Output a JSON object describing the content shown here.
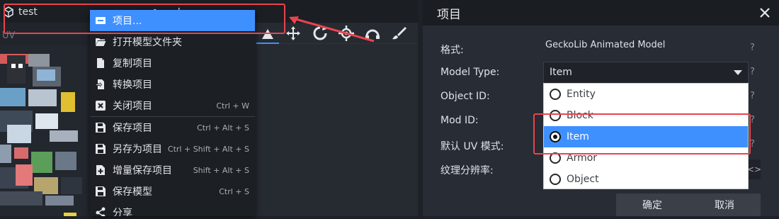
{
  "tab": {
    "title": "test",
    "plus_label": "+"
  },
  "uv": {
    "label": "UV"
  },
  "file_menu": {
    "items": [
      {
        "label": "项目...",
        "shortcut": "",
        "icon": "project-icon"
      },
      {
        "label": "打开模型文件夹",
        "shortcut": "",
        "icon": "folder-open-icon"
      },
      {
        "label": "复制项目",
        "shortcut": "",
        "icon": "copy-icon"
      },
      {
        "label": "转换项目",
        "shortcut": "",
        "icon": "convert-icon"
      },
      {
        "label": "关闭项目",
        "shortcut": "Ctrl + W",
        "icon": "close-box-icon"
      },
      {
        "label": "保存项目",
        "shortcut": "Ctrl + Alt + S",
        "icon": "save-icon"
      },
      {
        "label": "另存为项目",
        "shortcut": "Ctrl + Shift + Alt + S",
        "icon": "save-as-icon"
      },
      {
        "label": "增量保存项目",
        "shortcut": "Shift + Alt + S",
        "icon": "save-increment-icon"
      },
      {
        "label": "保存模型",
        "shortcut": "Ctrl + S",
        "icon": "save-model-icon"
      },
      {
        "label": "分享",
        "shortcut": "",
        "icon": "share-icon"
      }
    ]
  },
  "dialog": {
    "title": "项目",
    "fields": {
      "format_label": "格式:",
      "format_value": "GeckoLib Animated Model",
      "model_type_label": "Model Type:",
      "model_type_value": "Item",
      "object_id_label": "Object ID:",
      "mod_id_label": "Mod ID:",
      "uv_mode_label": "默认 UV 模式:",
      "texture_res_label": "纹理分辨率:"
    },
    "help": "?",
    "model_type_options": [
      "Entity",
      "Block",
      "Item",
      "Armor",
      "Object"
    ],
    "selected_option": "Item",
    "confirm_label": "确定",
    "cancel_label": "取消"
  },
  "colors": {
    "accent": "#3e90ff",
    "annotation": "#e8444f"
  }
}
